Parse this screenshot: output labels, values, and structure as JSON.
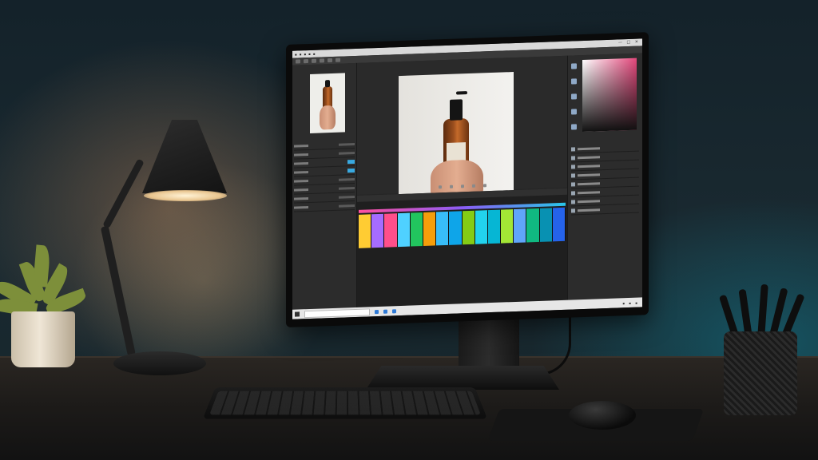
{
  "scene": {
    "description_free": true,
    "accent_colors": {
      "lamp_light": "#fff3d6",
      "wall_teal": "#1a2a31",
      "screen_bg": "#262626",
      "timeline_gradient_start": "#ff4fa0",
      "timeline_gradient_end": "#29c6e8"
    }
  },
  "editor": {
    "window_controls": "— □ ✕",
    "layers_count_shown": 8,
    "timeline_clips": [
      "#ffcc33",
      "#a66cff",
      "#ff4f8b",
      "#4fd1ff",
      "#22c55e",
      "#f59e0b",
      "#38bdf8",
      "#0ea5e9",
      "#84cc16",
      "#22d3ee",
      "#06b6d4",
      "#a3e635",
      "#60a5fa",
      "#10b981",
      "#0891b2",
      "#2563eb"
    ]
  }
}
